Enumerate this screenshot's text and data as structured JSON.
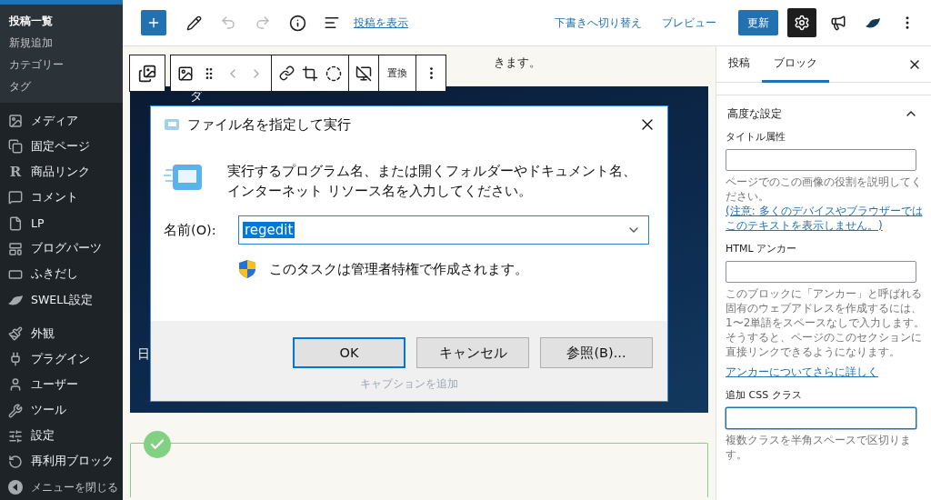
{
  "admin_menu": {
    "submenu": [
      {
        "label": "投稿一覧",
        "selected": true
      },
      {
        "label": "新規追加",
        "selected": false
      },
      {
        "label": "カテゴリー",
        "selected": false
      },
      {
        "label": "タグ",
        "selected": false
      }
    ],
    "items": [
      {
        "label": "メディア"
      },
      {
        "label": "固定ページ"
      },
      {
        "label": "商品リンク",
        "glyph": "R"
      },
      {
        "label": "コメント"
      },
      {
        "label": "LP"
      },
      {
        "label": "ブログパーツ"
      },
      {
        "label": "ふきだし"
      },
      {
        "label": "SWELL設定"
      },
      {
        "label": "外観"
      },
      {
        "label": "プラグイン"
      },
      {
        "label": "ユーザー"
      },
      {
        "label": "ツール"
      },
      {
        "label": "設定"
      },
      {
        "label": "再利用ブロック"
      }
    ],
    "collapse": "メニューを閉じる"
  },
  "top_toolbar": {
    "view_post_link": "投稿を表示",
    "switch_to_draft": "下書きへ切り替え",
    "preview": "プレビュー",
    "update": "更新",
    "settings_open": true
  },
  "block_toolbar": {
    "replace": "置換"
  },
  "editor": {
    "paragraph_fragment": "きます。",
    "image": {
      "desktop_labels": [
        "ダ",
        "日"
      ],
      "dialog": {
        "title": "ファイル名を指定して実行",
        "message": "実行するプログラム名、または開くフォルダーやドキュメント名、インターネット リソース名を入力してください。",
        "name_label": "名前(O):",
        "value": "regedit",
        "admin_note": "このタスクは管理者特権で作成されます。",
        "buttons": [
          {
            "label": "OK",
            "default": true
          },
          {
            "label": "キャンセル",
            "default": false
          },
          {
            "label": "参照(B)...",
            "default": false
          }
        ]
      },
      "caption_placeholder": "キャプションを追加"
    }
  },
  "settings_panel": {
    "tabs": [
      {
        "label": "投稿",
        "selected": false
      },
      {
        "label": "ブロック",
        "selected": true
      }
    ],
    "section": {
      "title": "高度な設定",
      "expanded": true
    },
    "fields": [
      {
        "label": "タイトル属性",
        "focused": false,
        "help": "ページでのこの画像の役割を説明してください。",
        "help_link": "(注意: 多くのデバイスやブラウザーではこのテキストを表示しません。)"
      },
      {
        "label": "HTML アンカー",
        "focused": false,
        "help": "このブロックに「アンカー」と呼ばれる固有のウェブアドレスを作成するには、1〜2単語をスペースなしで入力します。そうすると、ページのこのセクションに直接リンクできるようになります。",
        "more_link": "アンカーについてさらに詳しく"
      },
      {
        "label": "追加 CSS クラス",
        "focused": true,
        "help": "複数クラスを半角スペースで区切ります。"
      }
    ]
  }
}
